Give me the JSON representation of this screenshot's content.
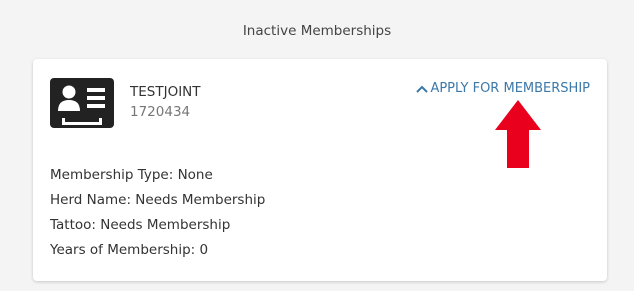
{
  "section": {
    "heading": "Inactive Memberships"
  },
  "membership_card": {
    "name": "TESTJOINT",
    "number": "1720434",
    "apply_label": "APPLY FOR MEMBERSHIP",
    "details": [
      "Membership Type: None",
      "Herd Name: Needs Membership",
      "Tattoo: Needs Membership",
      "Years of Membership: 0"
    ]
  },
  "icons": {
    "id_card": "id-card-icon",
    "chevron": "chevron-up-icon",
    "annotation": "red-arrow-up"
  },
  "colors": {
    "background": "#f4f4f4",
    "card": "#ffffff",
    "link": "#3c78a8",
    "annotation_arrow": "#e8001c",
    "icon": "#222222"
  }
}
